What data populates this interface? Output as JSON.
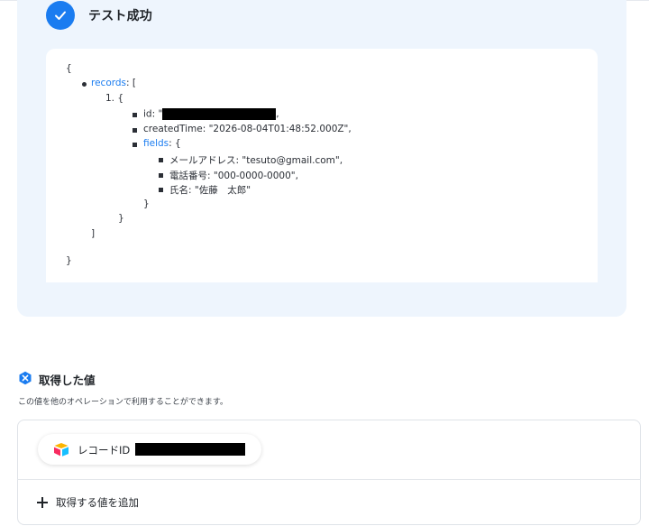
{
  "result": {
    "title": "テスト成功",
    "json_lines": {
      "open_brace": "{",
      "records_key": "records",
      "records_sep": ": [",
      "item_num": "1. {",
      "id_label": "id: \"",
      "id_tail": ",",
      "created_time": "createdTime: \"2026-08-04T01:48:52.000Z\",",
      "fields_key": "fields",
      "fields_sep": ": {",
      "mail": "メールアドレス: \"tesuto@gmail.com\",",
      "phone": "電話番号: \"000-0000-0000\",",
      "name": "氏名: \"佐藤　太郎\"",
      "close_fields": "}",
      "close_item": "}",
      "close_array": "]",
      "close_root": "}"
    }
  },
  "acquired": {
    "title": "取得した値",
    "description": "この値を他のオペレーションで利用することができます。",
    "chip_label": "レコードID",
    "add_label": "取得する値を追加"
  },
  "colors": {
    "accent": "#1a7cf0",
    "panel_bg": "#eef5fd"
  },
  "icons": {
    "check": "check-icon",
    "acquired": "hexagon-x-icon",
    "chip": "airtable-logo-icon",
    "add": "plus-icon"
  }
}
